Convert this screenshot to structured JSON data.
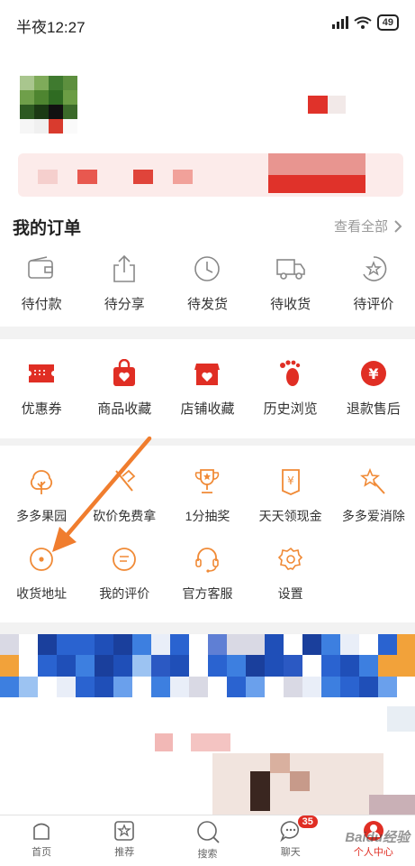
{
  "status_bar": {
    "time": "半夜12:27",
    "battery": "49"
  },
  "orders": {
    "title": "我的订单",
    "view_all": "查看全部",
    "items": [
      {
        "label": "待付款",
        "icon": "wallet-icon"
      },
      {
        "label": "待分享",
        "icon": "share-icon"
      },
      {
        "label": "待发货",
        "icon": "clock-icon"
      },
      {
        "label": "待收货",
        "icon": "truck-icon"
      },
      {
        "label": "待评价",
        "icon": "review-icon"
      }
    ]
  },
  "shortcuts": {
    "items": [
      {
        "label": "优惠券",
        "icon": "coupon-icon"
      },
      {
        "label": "商品收藏",
        "icon": "bag-heart-icon"
      },
      {
        "label": "店铺收藏",
        "icon": "shop-heart-icon"
      },
      {
        "label": "历史浏览",
        "icon": "footprint-icon"
      },
      {
        "label": "退款售后",
        "icon": "refund-icon"
      }
    ]
  },
  "services": {
    "row1": [
      {
        "label": "多多果园",
        "icon": "tree-icon"
      },
      {
        "label": "砍价免费拿",
        "icon": "axe-icon"
      },
      {
        "label": "1分抽奖",
        "icon": "trophy-icon"
      },
      {
        "label": "天天领现金",
        "icon": "cash-icon"
      },
      {
        "label": "多多爱消除",
        "icon": "wand-icon"
      }
    ],
    "row2": [
      {
        "label": "收货地址",
        "icon": "location-icon"
      },
      {
        "label": "我的评价",
        "icon": "comment-icon"
      },
      {
        "label": "官方客服",
        "icon": "headset-icon"
      },
      {
        "label": "设置",
        "icon": "settings-icon"
      }
    ]
  },
  "tabbar": {
    "items": [
      {
        "label": "首页",
        "icon": "home-icon"
      },
      {
        "label": "推荐",
        "icon": "recommend-icon"
      },
      {
        "label": "搜索",
        "icon": "search-icon"
      },
      {
        "label": "聊天",
        "icon": "chat-icon",
        "badge": "35"
      },
      {
        "label": "个人中心",
        "icon": "profile-icon"
      }
    ]
  },
  "watermark": "Baidu经验",
  "colors": {
    "accent": "#e02e24",
    "service": "#f08a36",
    "annotation_arrow": "#f07d2e"
  }
}
